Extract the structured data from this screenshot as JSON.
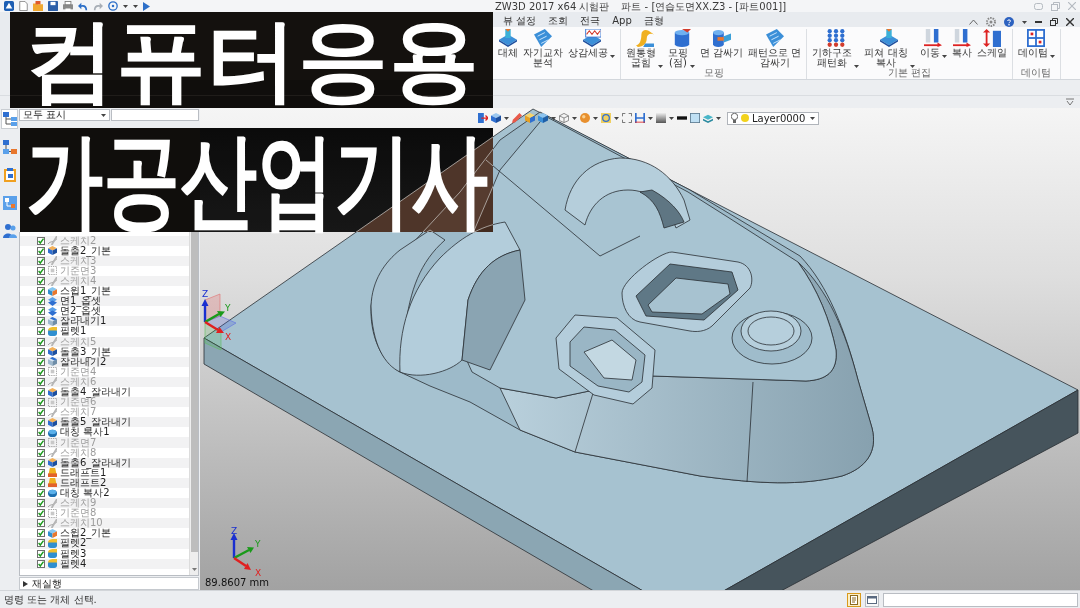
{
  "title_bar": {
    "app": "ZW3D 2017 x64 시험판",
    "document": "파트 - [연습도면XX.Z3 - [파트001]]"
  },
  "menu_tabs": [
    {
      "label": "뷰 설정",
      "selected": false
    },
    {
      "label": "조회",
      "selected": false
    },
    {
      "label": "전극",
      "selected": false
    },
    {
      "label": "App",
      "selected": false
    },
    {
      "label": "금형",
      "selected": false
    }
  ],
  "ribbon": {
    "groups": [
      {
        "buttons": [
          {
            "label": "대체",
            "dropdown": false
          },
          {
            "label": "자기교차\n분석",
            "dropdown": false
          },
          {
            "label": "상감세공",
            "dropdown": true
          }
        ]
      },
      {
        "label": "모핑",
        "buttons": [
          {
            "label": "원통형\n굽힘",
            "dropdown": true
          },
          {
            "label": "모핑\n(점)",
            "dropdown": true
          },
          {
            "label": "면 감싸기",
            "dropdown": false
          },
          {
            "label": "패턴으로 면\n감싸기",
            "dropdown": false
          }
        ]
      },
      {
        "label": "기본 편집",
        "buttons": [
          {
            "label": "기하구조\n패턴화",
            "dropdown": true
          },
          {
            "label": "피쳐 대칭\n복사",
            "dropdown": true
          },
          {
            "label": "이동",
            "dropdown": true
          },
          {
            "label": "복사",
            "dropdown": false
          },
          {
            "label": "스케일",
            "dropdown": false
          }
        ]
      },
      {
        "label": "데이텀",
        "buttons": [
          {
            "label": "데이텀",
            "dropdown": true
          }
        ]
      }
    ]
  },
  "manager": {
    "left_strip": [
      {
        "selected": true
      },
      {
        "selected": false
      },
      {
        "selected": false
      },
      {
        "selected": false
      },
      {
        "selected": false
      }
    ],
    "filter": "모두 표시",
    "history": [
      {
        "label": "스케치2",
        "kind": "sketch",
        "checked": true,
        "dimmed": true
      },
      {
        "label": "돌출2_기본",
        "kind": "extrude",
        "checked": true,
        "dimmed": false
      },
      {
        "label": "스케치3",
        "kind": "sketch",
        "checked": true,
        "dimmed": true
      },
      {
        "label": "기준면3",
        "kind": "datum",
        "checked": true,
        "dimmed": true
      },
      {
        "label": "스케치4",
        "kind": "sketch",
        "checked": true,
        "dimmed": true
      },
      {
        "label": "스윕1_기본",
        "kind": "sweep",
        "checked": true,
        "dimmed": false
      },
      {
        "label": "면1_옵셋",
        "kind": "offset",
        "checked": true,
        "dimmed": false
      },
      {
        "label": "면2_옵셋",
        "kind": "offset",
        "checked": true,
        "dimmed": false
      },
      {
        "label": "잘라내기1",
        "kind": "cut",
        "checked": true,
        "dimmed": false
      },
      {
        "label": "필렛1",
        "kind": "fillet",
        "checked": true,
        "dimmed": false
      },
      {
        "label": "스케치5",
        "kind": "sketch",
        "checked": true,
        "dimmed": true
      },
      {
        "label": "돌출3_기본",
        "kind": "extrude",
        "checked": true,
        "dimmed": false
      },
      {
        "label": "잘라내기2",
        "kind": "cut",
        "checked": true,
        "dimmed": false
      },
      {
        "label": "기준면4",
        "kind": "datum",
        "checked": true,
        "dimmed": true
      },
      {
        "label": "스케치6",
        "kind": "sketch",
        "checked": true,
        "dimmed": true
      },
      {
        "label": "돌출4_잘라내기",
        "kind": "extrude",
        "checked": true,
        "dimmed": false
      },
      {
        "label": "기준면6",
        "kind": "datum",
        "checked": true,
        "dimmed": true
      },
      {
        "label": "스케치7",
        "kind": "sketch",
        "checked": true,
        "dimmed": true
      },
      {
        "label": "돌출5_잘라내기",
        "kind": "extrude",
        "checked": true,
        "dimmed": false
      },
      {
        "label": "대칭 복사1",
        "kind": "mirror",
        "checked": true,
        "dimmed": false
      },
      {
        "label": "기준면7",
        "kind": "datum",
        "checked": true,
        "dimmed": true
      },
      {
        "label": "스케치8",
        "kind": "sketch",
        "checked": true,
        "dimmed": true
      },
      {
        "label": "돌출6_잘라내기",
        "kind": "extrude",
        "checked": true,
        "dimmed": false
      },
      {
        "label": "드래프트1",
        "kind": "draft",
        "checked": true,
        "dimmed": false
      },
      {
        "label": "드래프트2",
        "kind": "draft",
        "checked": true,
        "dimmed": false
      },
      {
        "label": "대칭 복사2",
        "kind": "mirror",
        "checked": true,
        "dimmed": false
      },
      {
        "label": "스케치9",
        "kind": "sketch",
        "checked": true,
        "dimmed": true
      },
      {
        "label": "기준면8",
        "kind": "datum",
        "checked": true,
        "dimmed": true
      },
      {
        "label": "스케치10",
        "kind": "sketch",
        "checked": true,
        "dimmed": true
      },
      {
        "label": "스윕2_기본",
        "kind": "sweep",
        "checked": true,
        "dimmed": false
      },
      {
        "label": "필렛2",
        "kind": "fillet",
        "checked": true,
        "dimmed": false
      },
      {
        "label": "필렛3",
        "kind": "fillet",
        "checked": true,
        "dimmed": false
      },
      {
        "label": "필렛4",
        "kind": "fillet",
        "checked": true,
        "dimmed": false
      }
    ],
    "replay": {
      "label": "재실행",
      "expanded": false
    }
  },
  "viewport": {
    "layer": "Layer0000",
    "triads": [
      {
        "labels": [
          "Z",
          "Y",
          "X"
        ]
      },
      {
        "labels": [
          "Z",
          "Y",
          "X"
        ]
      }
    ],
    "scale": "89.8607 mm"
  },
  "status_bar": {
    "message": "명령 또는 개체 선택.",
    "tools": [
      {
        "selected": true
      },
      {
        "selected": false
      }
    ]
  },
  "banner": {
    "lines": [
      "컴퓨터응용",
      "가공산업기사"
    ]
  }
}
